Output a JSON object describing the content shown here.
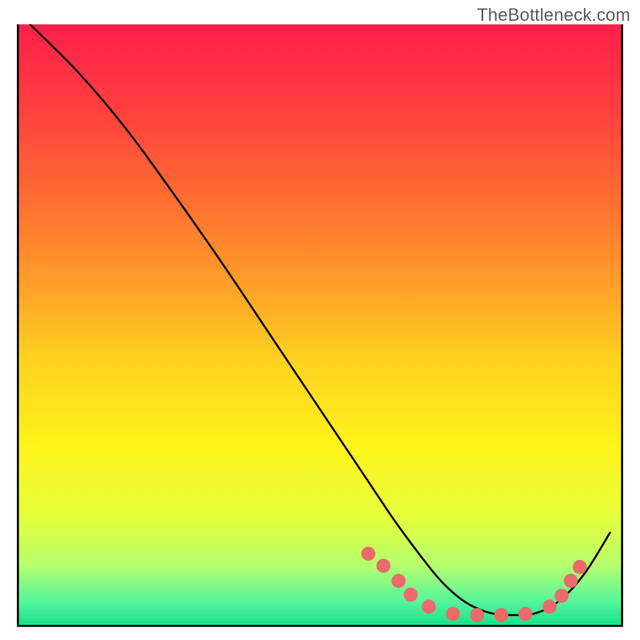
{
  "watermark": "TheBottleneck.com",
  "chart_data": {
    "type": "line",
    "title": "",
    "xlabel": "",
    "ylabel": "",
    "xlim": [
      0,
      100
    ],
    "ylim": [
      0,
      100
    ],
    "grid": false,
    "legend": false,
    "background": {
      "type": "vertical-gradient",
      "stops": [
        {
          "offset": 0.0,
          "color": "#ff1f4b"
        },
        {
          "offset": 0.14,
          "color": "#ff3f3f"
        },
        {
          "offset": 0.28,
          "color": "#ff6a33"
        },
        {
          "offset": 0.42,
          "color": "#ff9a2a"
        },
        {
          "offset": 0.56,
          "color": "#ffd21f"
        },
        {
          "offset": 0.7,
          "color": "#fff31a"
        },
        {
          "offset": 0.82,
          "color": "#e4ff3c"
        },
        {
          "offset": 0.9,
          "color": "#b4ff6e"
        },
        {
          "offset": 0.96,
          "color": "#55f59d"
        },
        {
          "offset": 1.0,
          "color": "#17e08a"
        }
      ]
    },
    "series": [
      {
        "name": "curve",
        "color": "#000000",
        "x": [
          2,
          10,
          18,
          26,
          34,
          42,
          50,
          58,
          62,
          66,
          70,
          74,
          78,
          82,
          86,
          90,
          94,
          98
        ],
        "y": [
          100,
          92,
          82.5,
          71.5,
          60,
          48,
          36,
          24,
          18,
          12.5,
          7.5,
          4,
          2.2,
          1.8,
          2.2,
          4.5,
          9,
          15.5
        ]
      }
    ],
    "points": {
      "name": "markers",
      "color": "#ec6a6a",
      "radius_pct": 1.1,
      "x": [
        58,
        60.5,
        63,
        65,
        68,
        72,
        76,
        80,
        84,
        88,
        90,
        91.5,
        93
      ],
      "y": [
        12,
        10,
        7.5,
        5.2,
        3.2,
        2.0,
        1.8,
        1.8,
        2.0,
        3.2,
        5.0,
        7.5,
        9.8
      ]
    },
    "frame": {
      "top_pct": 3.8,
      "left_pct": 2.8,
      "right_pct": 97.2,
      "bottom_pct": 97.8
    }
  }
}
